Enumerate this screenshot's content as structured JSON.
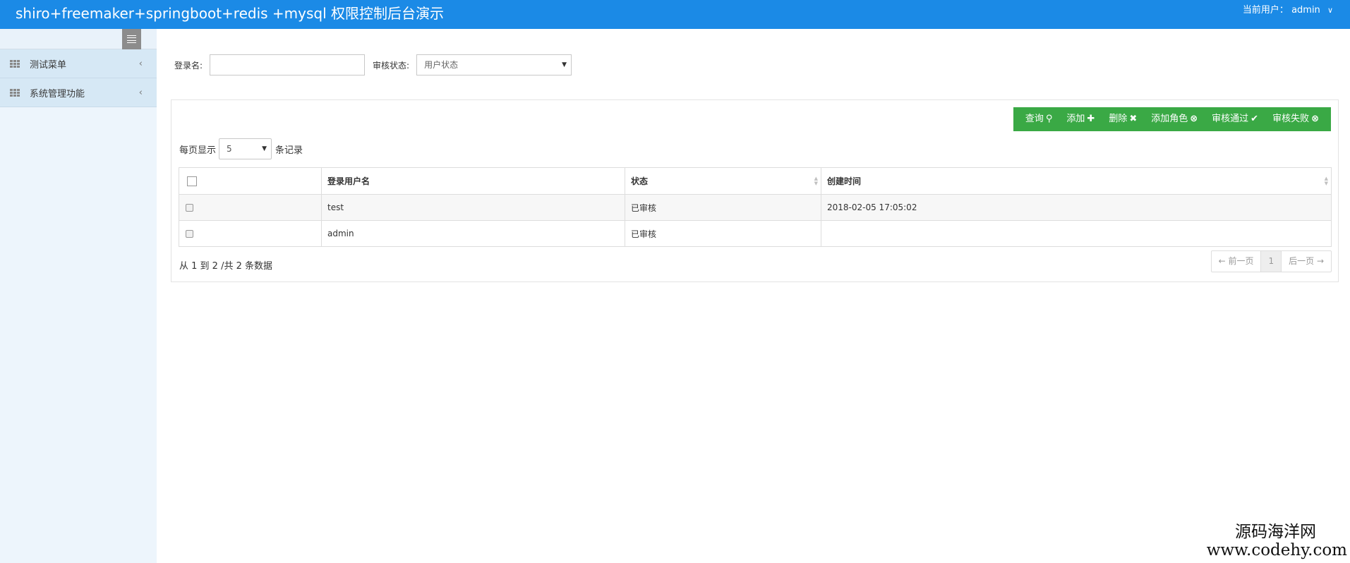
{
  "header": {
    "title": "shiro+freemaker+springboot+redis +mysql 权限控制后台演示",
    "current_user_label": "当前用户：",
    "current_user": "admin"
  },
  "sidebar": {
    "items": [
      {
        "label": "测试菜单"
      },
      {
        "label": "系统管理功能"
      }
    ]
  },
  "filters": {
    "login_name_label": "登录名:",
    "login_name_value": "",
    "status_label": "审核状态:",
    "status_selected": "用户状态"
  },
  "toolbar": {
    "buttons": [
      {
        "label": "查询",
        "icon": "search-icon",
        "glyph": "🔍"
      },
      {
        "label": "添加",
        "icon": "plus-icon",
        "glyph": "✚"
      },
      {
        "label": "删除",
        "icon": "times-icon",
        "glyph": "✖"
      },
      {
        "label": "添加角色",
        "icon": "circle-x-icon",
        "glyph": "⊗"
      },
      {
        "label": "审核通过",
        "icon": "check-circle-icon",
        "glyph": "⊘"
      },
      {
        "label": "审核失败",
        "icon": "circle-x-icon",
        "glyph": "⊗"
      }
    ]
  },
  "page_size": {
    "prefix": "每页显示",
    "value": "5",
    "suffix": "条记录"
  },
  "table": {
    "headers": {
      "username": "登录用户名",
      "status": "状态",
      "created": "创建时间"
    },
    "rows": [
      {
        "username": "test",
        "status": "已审核",
        "created": "2018-02-05 17:05:02"
      },
      {
        "username": "admin",
        "status": "已审核",
        "created": ""
      }
    ]
  },
  "footer": {
    "info": "从 1 到 2 /共 2 条数据",
    "prev": "← 前一页",
    "current_page": "1",
    "next": "后一页 →"
  },
  "watermark": {
    "line1": "源码海洋网",
    "line2": "www.codehy.com"
  },
  "colors": {
    "header_bg": "#1b8ae6",
    "toolbar_bg": "#3aa945",
    "sidebar_bg": "#edf5fc"
  }
}
